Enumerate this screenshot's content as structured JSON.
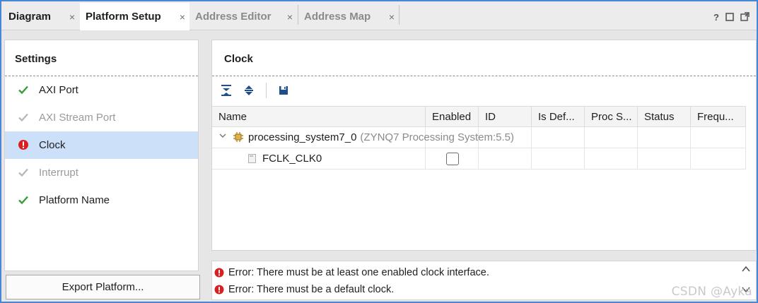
{
  "tabs": [
    {
      "label": "Diagram",
      "active": false,
      "enabled": true
    },
    {
      "label": "Platform Setup",
      "active": true,
      "enabled": true
    },
    {
      "label": "Address Editor",
      "active": false,
      "enabled": false
    },
    {
      "label": "Address Map",
      "active": false,
      "enabled": false
    }
  ],
  "tab_close_glyph": "×",
  "window_icons": [
    "help-icon",
    "restore-icon",
    "float-icon"
  ],
  "settings": {
    "title": "Settings",
    "items": [
      {
        "label": "AXI Port",
        "status": "ok",
        "enabled": true
      },
      {
        "label": "AXI Stream Port",
        "status": "ok-disabled",
        "enabled": false
      },
      {
        "label": "Clock",
        "status": "error",
        "enabled": true,
        "selected": true
      },
      {
        "label": "Interrupt",
        "status": "ok-disabled",
        "enabled": false
      },
      {
        "label": "Platform Name",
        "status": "ok",
        "enabled": true
      }
    ],
    "export_button": "Export Platform..."
  },
  "clock": {
    "title": "Clock",
    "toolbar": [
      "collapse-all-icon",
      "expand-all-icon",
      "save-icon"
    ],
    "columns": [
      "Name",
      "Enabled",
      "ID",
      "Is Def...",
      "Proc S...",
      "Status",
      "Frequ..."
    ],
    "rows": [
      {
        "name": "processing_system7_0",
        "detail": "(ZYNQ7 Processing System:5.5)",
        "expanded": true,
        "type": "instance"
      },
      {
        "name": "FCLK_CLK0",
        "enabled": false,
        "type": "clock"
      }
    ]
  },
  "messages": [
    {
      "level": "error",
      "text": "Error: There must be at least one enabled clock interface."
    },
    {
      "level": "error",
      "text": "Error: There must be a default clock."
    }
  ],
  "watermark": "CSDN @Ayka",
  "colors": {
    "accent_border": "#4a86d6",
    "selection": "#cde0fa",
    "ok_green": "#3a9c3a",
    "error_red": "#d92020",
    "disabled_text": "#9a9a9a"
  }
}
